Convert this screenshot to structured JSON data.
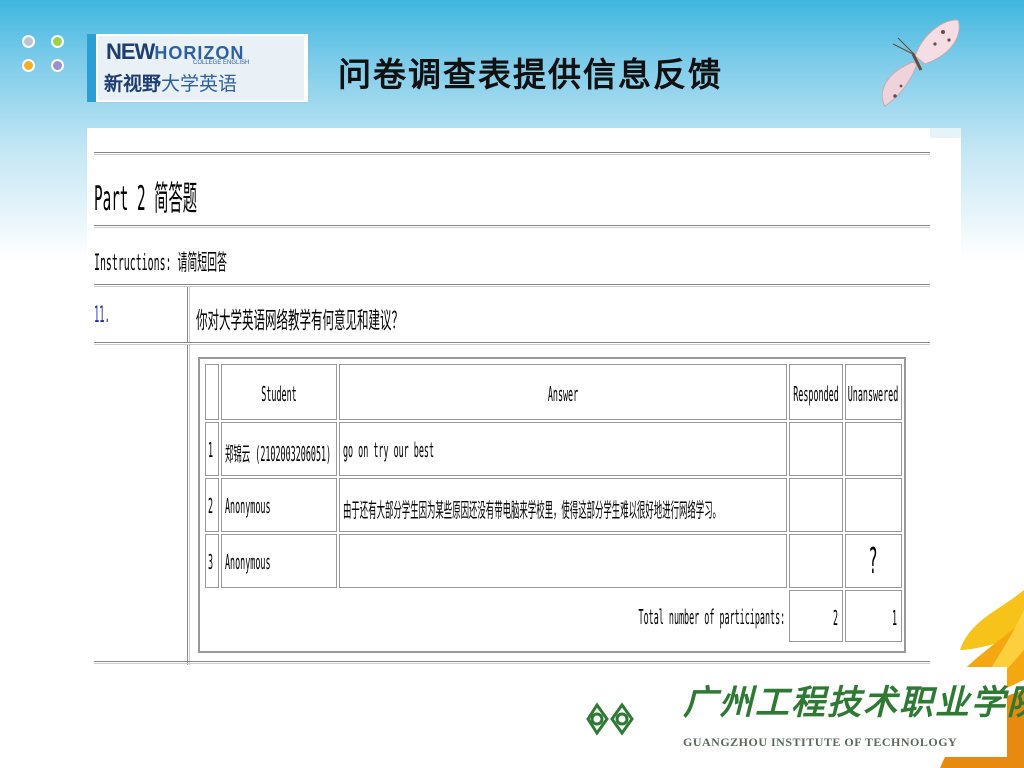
{
  "slide": {
    "title": "问卷调查表提供信息反馈",
    "logo": {
      "line1": "NEW",
      "line1b": "HORIZON",
      "sub": "COLLEGE ENGLISH",
      "line2a": "新视野",
      "line2b": "大学英语"
    },
    "footer_logo": {
      "cn": "广州工程技术职业学院",
      "en": "GUANGZHOU INSTITUTE OF TECHNOLOGY"
    },
    "dot_colors": [
      "#b9c4d6",
      "#9ad24a",
      "#f2b020",
      "#9b8fd6"
    ]
  },
  "survey": {
    "part_title": "Part 2 简答题",
    "instructions": "Instructions: 请简短回答",
    "question": {
      "number": "11.",
      "text": "你对大学英语网络教学有何意见和建议？"
    },
    "table": {
      "headers": [
        "Student",
        "Answer",
        "Responded",
        "Unanswered"
      ],
      "rows": [
        {
          "num": "1",
          "student": "郑锦云 (2102003206051)",
          "answer": "go on try our best",
          "responded": "",
          "unanswered": ""
        },
        {
          "num": "2",
          "student": "Anonymous",
          "answer": "由于还有大部分学生因为某些原因还没有带电脑来学校里，使得这部分学生难以很好地进行网络学习。",
          "responded": "",
          "unanswered": ""
        },
        {
          "num": "3",
          "student": "Anonymous",
          "answer": "",
          "responded": "",
          "unanswered": "?"
        }
      ],
      "total_label": "Total number of participants:",
      "total_responded": "2",
      "total_unanswered": "1"
    }
  }
}
